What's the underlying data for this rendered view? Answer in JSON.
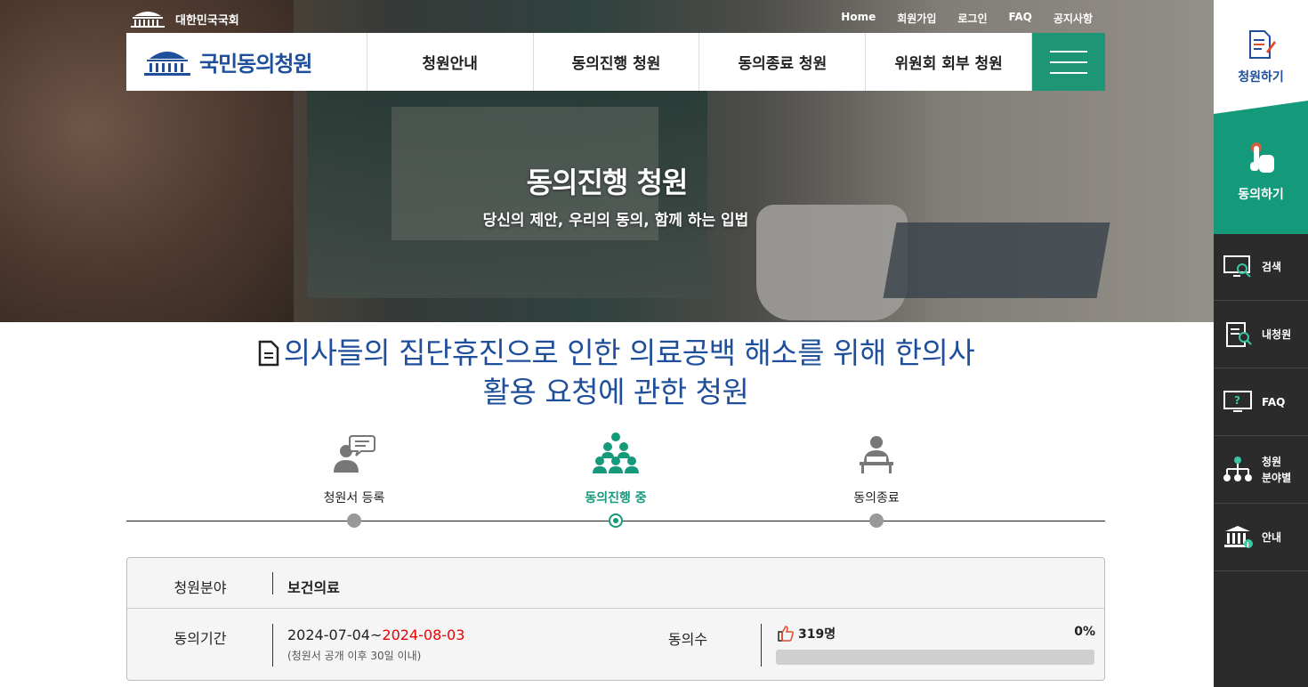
{
  "header": {
    "org_name": "대한민국국회",
    "top_links": [
      "Home",
      "회원가입",
      "로그인",
      "FAQ",
      "공지사항"
    ],
    "site_name": "국민동의청원",
    "nav": [
      "청원안내",
      "동의진행 청원",
      "동의종료 청원",
      "위원회 회부 청원"
    ]
  },
  "hero": {
    "title": "동의진행 청원",
    "subtitle": "당신의 제안, 우리의 동의, 함께 하는 입법"
  },
  "sidebar": {
    "write": "청원하기",
    "agree": "동의하기",
    "items": [
      {
        "label": "검색",
        "icon": "search-monitor-icon"
      },
      {
        "label": "내청원",
        "icon": "my-document-icon"
      },
      {
        "label": "FAQ",
        "icon": "faq-monitor-icon"
      },
      {
        "label": "청원\n분야별",
        "icon": "org-chart-icon"
      },
      {
        "label": "안내",
        "icon": "building-info-icon"
      }
    ]
  },
  "petition": {
    "title_line1": "의사들의 집단휴진으로 인한 의료공백 해소를 위해 한의사",
    "title_line2": "활용 요청에 관한 청원"
  },
  "stages": [
    {
      "label": "청원서 등록",
      "active": false
    },
    {
      "label": "동의진행 중",
      "active": true
    },
    {
      "label": "동의종료",
      "active": false
    }
  ],
  "info": {
    "field_label": "청원분야",
    "field_value": "보건의료",
    "period_label": "동의기간",
    "period_start": "2024-07-04~",
    "period_end": "2024-08-03",
    "period_note": "(청원서 공개 이후 30일 이내)",
    "count_label": "동의수",
    "count_value": "319명",
    "percent_text": "0%",
    "progress": 0
  },
  "colors": {
    "brand_blue": "#1f4e9b",
    "brand_green": "#14997a",
    "deadline_red": "#e00000"
  }
}
